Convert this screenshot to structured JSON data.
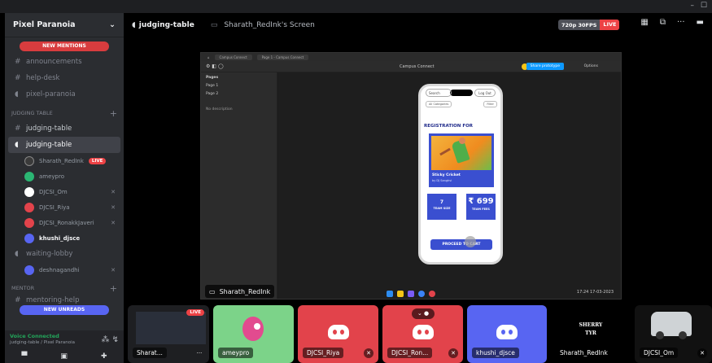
{
  "window": {
    "controls": [
      "–",
      "☐"
    ]
  },
  "sidebar": {
    "server_name": "Pixel Paranoia",
    "new_mentions": "NEW MENTIONS",
    "new_unreads": "NEW UNREADS",
    "channels_top": [
      {
        "name": "announcements",
        "icon": "hash"
      },
      {
        "name": "help-desk",
        "icon": "hash"
      },
      {
        "name": "pixel-paranoia",
        "icon": "speaker"
      }
    ],
    "category_judging": "JUDGING TABLE",
    "channel_judging_text": "judging-table",
    "channel_judging_voice": "judging-table",
    "voice_users": [
      {
        "name": "Sharath_RedInk",
        "live": "LIVE",
        "color": "#3a3a3a"
      },
      {
        "name": "ameypro",
        "color": "#2bb673"
      },
      {
        "name": "DJCSI_Om",
        "color": "#ffffff"
      },
      {
        "name": "DJCSI_Riya",
        "color": "#e2434b"
      },
      {
        "name": "DJCSI_RonakkJaveri",
        "color": "#e2434b"
      },
      {
        "name": "khushi_djsce",
        "color": "#5865f2"
      }
    ],
    "channel_waiting": "waiting-lobby",
    "waiting_user": "deshnagandhi",
    "category_mentor": "MENTOR",
    "channel_mentoring": "mentoring-help",
    "voice_connected": "Voice Connected",
    "voice_location": "judging-table / Pixel Paranoia"
  },
  "topbar": {
    "channel": "judging-table",
    "screen_title": "Sharath_RedInk's Screen",
    "quality": "720p 30FPS",
    "live": "LIVE"
  },
  "screen": {
    "tab_app": "Campus Connect",
    "tab_page": "Page 1 - Campus Connect",
    "project": "Campus Connect",
    "share_btn": "Share prototype",
    "options": "Options",
    "pages_header": "Pages",
    "page1": "Page 1",
    "page2": "Page 2",
    "no_description": "No description",
    "owner_label": "Sharath_RedInk",
    "tray_time": "17:24",
    "tray_date": "17-03-2023"
  },
  "phone": {
    "search": "Search",
    "logout": "Log Out",
    "filter_cat": "All Categories",
    "filter": "Filter",
    "heading": "REGISTRATION FOR",
    "card_name": "Sticky Cricket",
    "card_sub": "by DJ Sanghvi",
    "team_size_value": "7",
    "team_size_label": "TEAM SIZE",
    "team_fees_value": "₹ 699",
    "team_fees_label": "TEAM FEES",
    "proceed": "PROCEED TO CART"
  },
  "tiles": [
    {
      "name": "Sharat...",
      "bg": "#1e1f22"
    },
    {
      "name": "ameypro",
      "bg": "#7cd389"
    },
    {
      "name": "DJCSI_Riya",
      "bg": "#e2434b"
    },
    {
      "name": "DJCSI_Ron...",
      "bg": "#e2434b"
    },
    {
      "name": "khushi_djsce",
      "bg": "#5865f2"
    },
    {
      "name": "Sharath_RedInk",
      "bg": "#000000"
    },
    {
      "name": "DJCSI_Om",
      "bg": "#111111"
    }
  ],
  "tile_extra": {
    "avatar_text_1": "SHERRY",
    "avatar_text_2": "TYR",
    "live": "LIVE"
  },
  "colors": {
    "live_red": "#ed4245",
    "blurple": "#5865f2",
    "voice_green": "#23a55a"
  }
}
